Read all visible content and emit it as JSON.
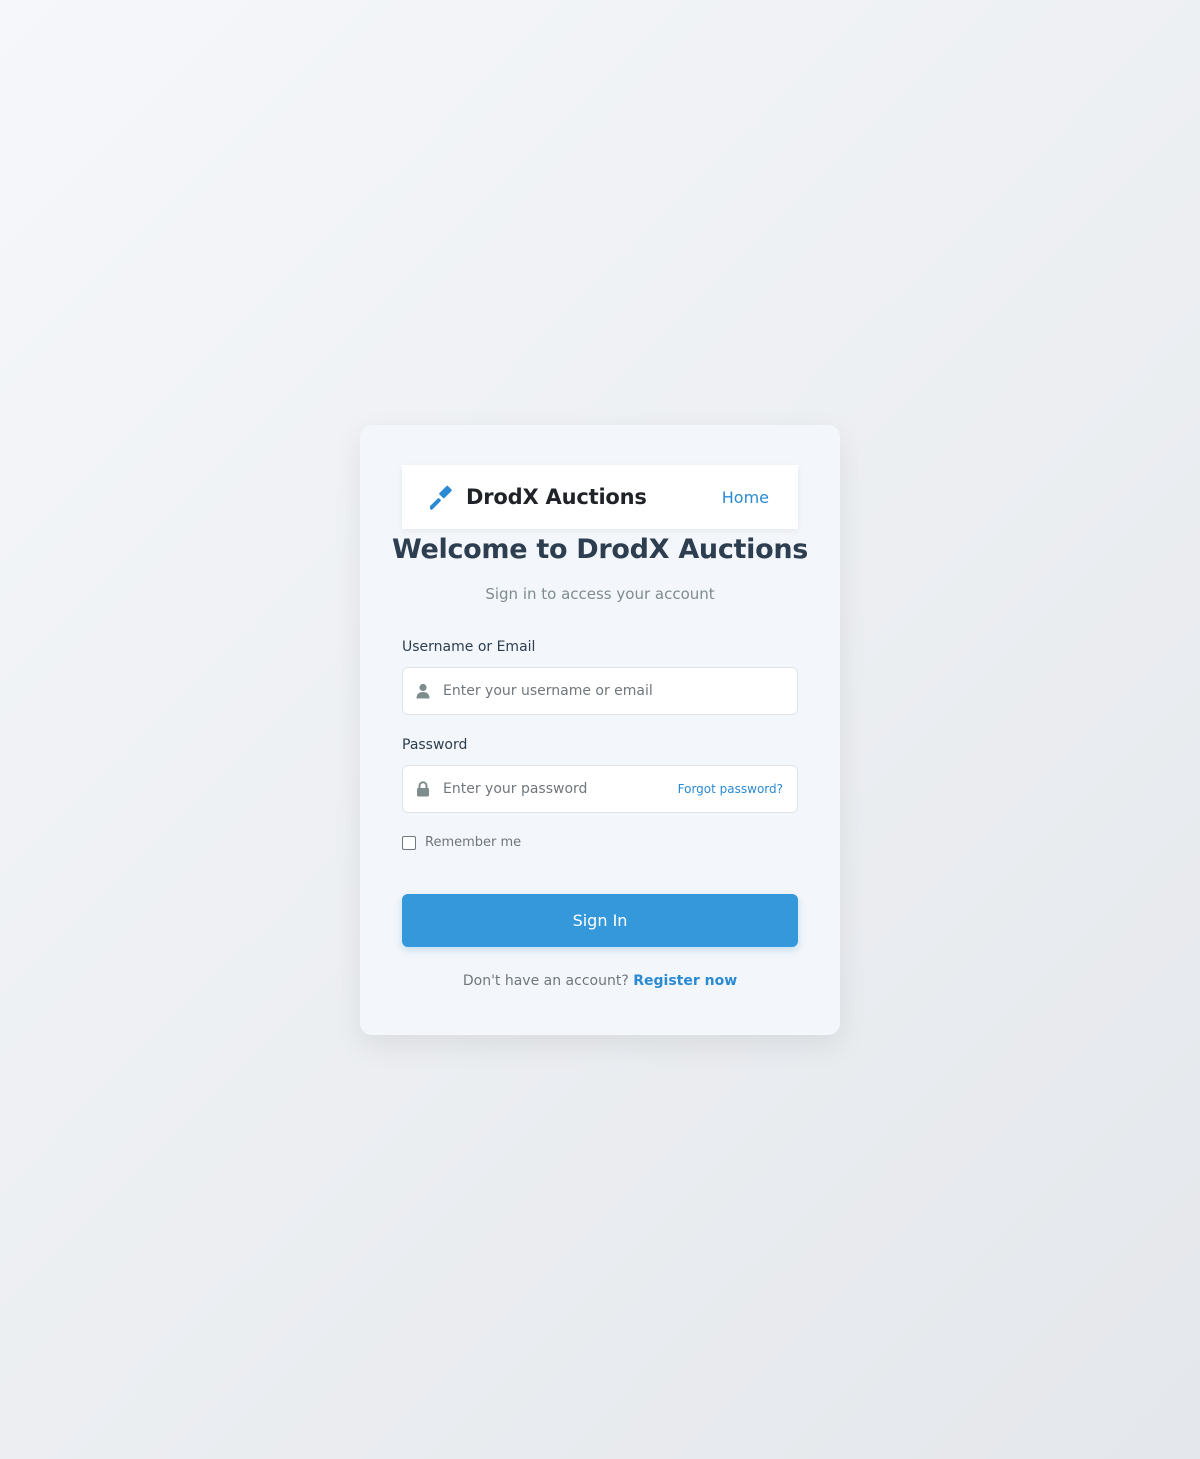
{
  "navbar": {
    "brand_name": "DrodX Auctions",
    "brand_icon": "gavel-icon",
    "home_link": "Home"
  },
  "title": "Welcome to DrodX Auctions",
  "subtitle": "Sign in to access your account",
  "username": {
    "label": "Username or Email",
    "placeholder": "Enter your username or email",
    "value": "",
    "icon": "user-icon"
  },
  "password": {
    "label": "Password",
    "placeholder": "Enter your password",
    "value": "",
    "icon": "lock-icon",
    "forgot_link": "Forgot password?"
  },
  "remember": {
    "label": "Remember me",
    "checked": false
  },
  "signin_button": "Sign In",
  "footer": {
    "prompt": "Don't have an account?",
    "register_link": "Register now"
  },
  "colors": {
    "accent": "#3498db",
    "link": "#2a8ad4",
    "heading": "#2c3e50",
    "muted": "#7f8c8d"
  }
}
